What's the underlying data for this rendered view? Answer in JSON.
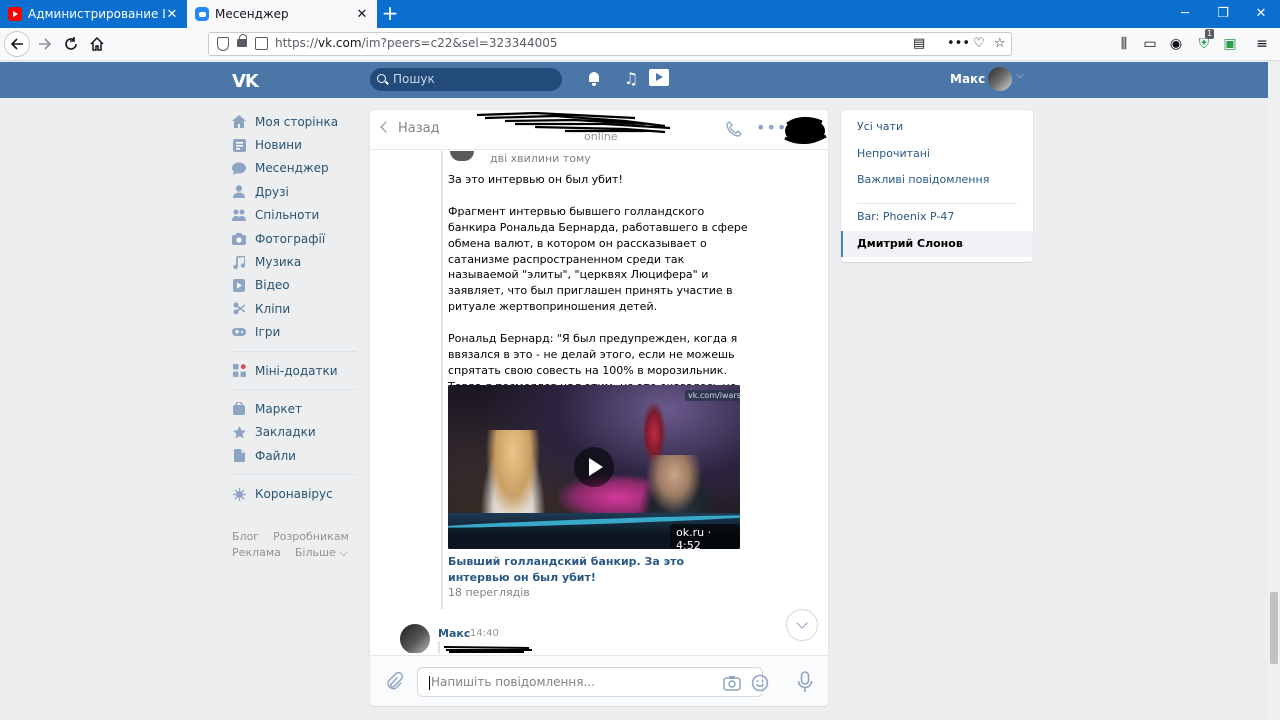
{
  "browser": {
    "tabs": [
      {
        "title": "Администрирование Linux. Л",
        "icon": "youtube-icon"
      },
      {
        "title": "Месенджер",
        "icon": "vk-messenger-icon"
      }
    ],
    "url_prefix": "https://",
    "url_host": "vk.com",
    "url_path": "/im?peers=c22&sel=323344005",
    "badge_count": "1"
  },
  "vk_header": {
    "logo": "VK",
    "search_placeholder": "Пошук",
    "user_name": "Макс"
  },
  "left_menu": {
    "items": [
      {
        "label": "Моя сторінка",
        "icon": "home-icon"
      },
      {
        "label": "Новини",
        "icon": "news-icon"
      },
      {
        "label": "Месенджер",
        "icon": "messenger-icon"
      },
      {
        "label": "Друзі",
        "icon": "friend-icon"
      },
      {
        "label": "Спільноти",
        "icon": "communities-icon"
      },
      {
        "label": "Фотографії",
        "icon": "camera-icon"
      },
      {
        "label": "Музика",
        "icon": "music-icon"
      },
      {
        "label": "Відео",
        "icon": "video-icon"
      },
      {
        "label": "Кліпи",
        "icon": "clips-icon"
      },
      {
        "label": "Ігри",
        "icon": "gamepad-icon"
      }
    ],
    "group2": [
      {
        "label": "Міні-додатки",
        "icon": "apps-icon"
      }
    ],
    "group3": [
      {
        "label": "Маркет",
        "icon": "bag-icon"
      },
      {
        "label": "Закладки",
        "icon": "star-icon"
      },
      {
        "label": "Файли",
        "icon": "file-icon"
      }
    ],
    "group4": [
      {
        "label": "Коронавірус",
        "icon": "virus-icon"
      }
    ],
    "footer": {
      "blog": "Блог",
      "developers": "Розробникам",
      "ads": "Реклама",
      "more": "Більше ⌵"
    }
  },
  "chat": {
    "back_label": "Назад",
    "status": "online",
    "forwarded_time": "дві хвилини тому",
    "message_paragraphs": [
      "За это интервью он был убит!",
      "Фрагмент интервью бывшего голландского банкира Рональда Бернарда, работавшего в сфере обмена валют, в котором он рассказывает о сатанизме распространенном среди так называемой \"элиты\", \"церквях Люцифера\" и заявляет, что был приглашен принять участие в ритуале жертвоприношения детей.",
      "Рональд Бернард: \"Я был предупрежден, когда я ввязался в это - не делай этого, если не можешь спрятать свою совесть на 100% в морозильник. Тогда я посмеялся над этим, но это оказалось не шуткой\"."
    ],
    "video": {
      "watermark": "vk.com/iwars",
      "duration": "ok.ru · 4:52",
      "title": "Бывший голландский банкир. За это интервью он был убит!",
      "views": "18 переглядів"
    },
    "second_message": {
      "author": "Макс",
      "time": "14:40"
    },
    "composer_placeholder": "Напишіть повідомлення..."
  },
  "right_panel": {
    "items": [
      {
        "label": "Усі чати"
      },
      {
        "label": "Непрочитані"
      },
      {
        "label": "Важливі повідомлення"
      },
      {
        "label": "Bar: Phoenix P-47"
      },
      {
        "label": "Дмитрий Слонов",
        "selected": true
      }
    ]
  }
}
